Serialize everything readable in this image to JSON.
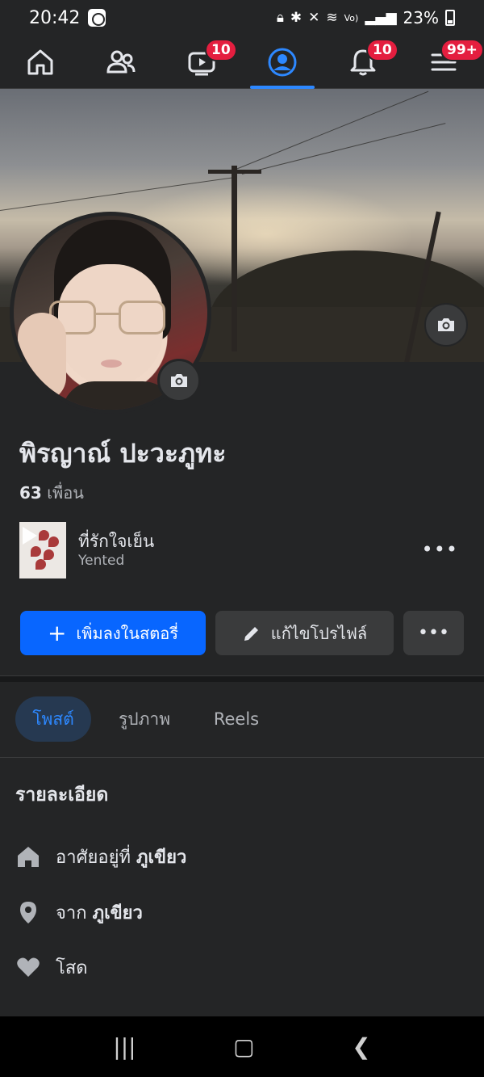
{
  "status_bar": {
    "time": "20:42",
    "battery": "23%",
    "icons": [
      "lock-icon",
      "bluetooth-icon",
      "mute-icon",
      "wifi-icon",
      "volte-icon",
      "signal-icon",
      "battery-icon"
    ]
  },
  "nav": {
    "items": [
      {
        "name": "home",
        "icon": "home-icon",
        "badge": ""
      },
      {
        "name": "friends",
        "icon": "friends-icon",
        "badge": ""
      },
      {
        "name": "watch",
        "icon": "video-icon",
        "badge": "10"
      },
      {
        "name": "profile",
        "icon": "profile-icon",
        "badge": "",
        "active": true
      },
      {
        "name": "notifications",
        "icon": "bell-icon",
        "badge": "10"
      },
      {
        "name": "menu",
        "icon": "menu-icon",
        "badge": "99+"
      }
    ]
  },
  "profile": {
    "name": "พิรญาณ์ ปะวะภูทะ",
    "friends_count": "63",
    "friends_label": "เพื่อน"
  },
  "music": {
    "title": "ที่รักใจเย็น",
    "artist": "Yented"
  },
  "actions": {
    "add_story": "เพิ่มลงในสตอรี่",
    "edit_profile": "แก้ไขโปรไฟล์"
  },
  "tabs": [
    "โพสต์",
    "รูปภาพ",
    "Reels"
  ],
  "details": {
    "title": "รายละเอียด",
    "lives_prefix": "อาศัยอยู่ที่",
    "lives_place": "ภูเขียว",
    "from_prefix": "จาก",
    "from_place": "ภูเขียว",
    "relationship": "โสด"
  },
  "colors": {
    "accent": "#0866ff",
    "badge": "#e41e3f",
    "bg": "#242526"
  }
}
